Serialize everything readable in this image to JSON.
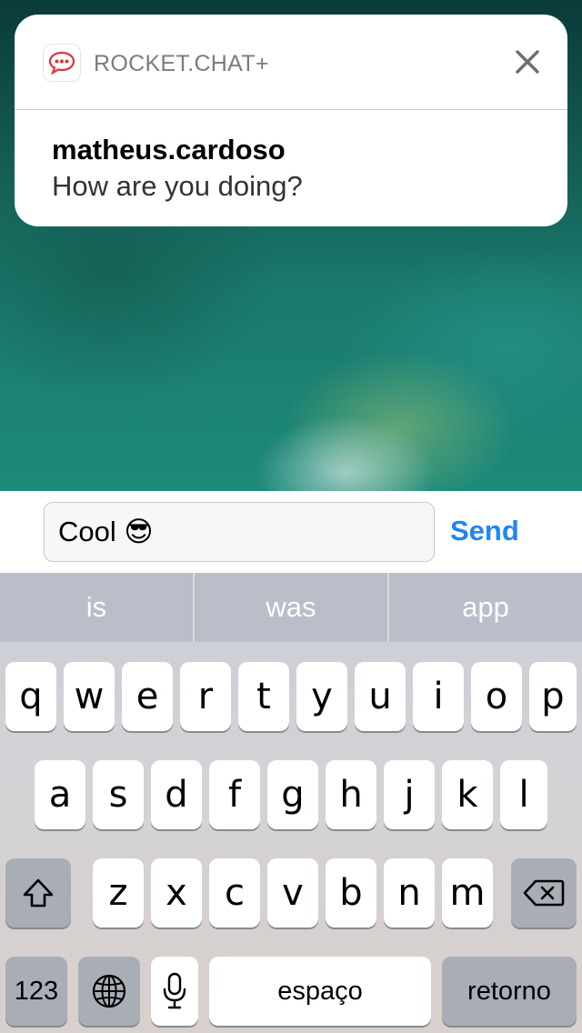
{
  "notification": {
    "app_name": "ROCKET.CHAT+",
    "app_icon": "rocket-chat-icon",
    "close_icon": "close-icon",
    "sender": "matheus.cardoso",
    "message": "How are you doing?"
  },
  "reply": {
    "text": "Cool 😎",
    "send_label": "Send",
    "accent": "#1f86f2"
  },
  "keyboard": {
    "suggestions": [
      "is",
      "was",
      "app"
    ],
    "row1": [
      "q",
      "w",
      "e",
      "r",
      "t",
      "y",
      "u",
      "i",
      "o",
      "p"
    ],
    "row2": [
      "a",
      "s",
      "d",
      "f",
      "g",
      "h",
      "j",
      "k",
      "l"
    ],
    "row3": [
      "z",
      "x",
      "c",
      "v",
      "b",
      "n",
      "m"
    ],
    "shift_icon": "shift-icon",
    "backspace_icon": "backspace-icon",
    "numbers_label": "123",
    "globe_icon": "globe-icon",
    "mic_icon": "microphone-icon",
    "space_label": "espaço",
    "return_label": "retorno"
  }
}
